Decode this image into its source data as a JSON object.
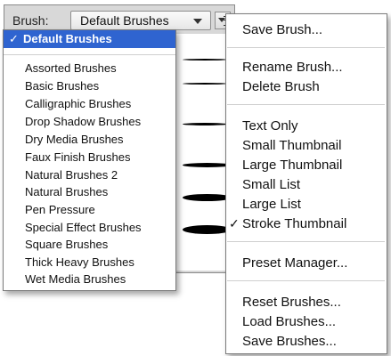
{
  "panel": {
    "brush_label": "Brush:",
    "selected_preset": "Default Brushes"
  },
  "preset_menu": {
    "selected": "Default Brushes",
    "items": [
      "Assorted Brushes",
      "Basic Brushes",
      "Calligraphic Brushes",
      "Drop Shadow Brushes",
      "Dry Media Brushes",
      "Faux Finish Brushes",
      "Natural Brushes 2",
      "Natural Brushes",
      "Pen Pressure",
      "Special Effect Brushes",
      "Square Brushes",
      "Thick Heavy Brushes",
      "Wet Media Brushes"
    ]
  },
  "flyout_menu": {
    "save_brush": "Save Brush...",
    "rename_brush": "Rename Brush...",
    "delete_brush": "Delete Brush",
    "text_only": "Text Only",
    "small_thumbnail": "Small Thumbnail",
    "large_thumbnail": "Large Thumbnail",
    "small_list": "Small List",
    "large_list": "Large List",
    "stroke_thumbnail": "Stroke Thumbnail",
    "preset_manager": "Preset Manager...",
    "reset_brushes": "Reset Brushes...",
    "load_brushes": "Load Brushes...",
    "save_brushes": "Save Brushes..."
  },
  "colors": {
    "highlight": "#2f64d0",
    "panel_bg": "#d8d8d8"
  }
}
